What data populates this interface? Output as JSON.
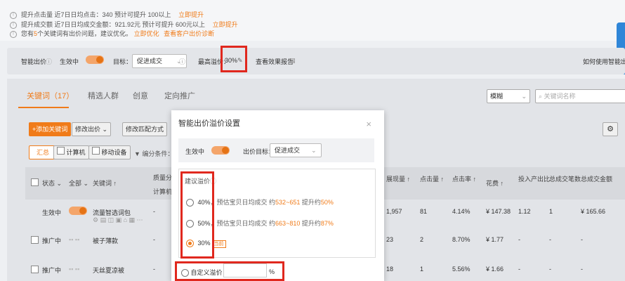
{
  "notice": {
    "rows": [
      {
        "text": "提升点击量 近7日日均点击：340    预计可提升 100以上",
        "link": "立即提升"
      },
      {
        "text": "提升成交额 近7日日均成交金额：921.92元    预计可提升 600元以上",
        "link": "立即提升"
      },
      {
        "text_prefix": "您有",
        "count": "5",
        "text_suffix": "个关键词有出价问题，建议优化。",
        "link": "立即优化",
        "link2": "查看客户出价诊断"
      }
    ]
  },
  "control_bar": {
    "smart_bid_label": "智能出价",
    "status_label": "生效中",
    "goal_label": "目标：",
    "goal_value": "促进成交",
    "max_premium_label": "最高溢价：",
    "max_premium_value": "30%",
    "report_link": "查看效果报告",
    "help_link": "如何使用智能出"
  },
  "tabs": [
    {
      "label": "关键词（17）",
      "active": true
    },
    {
      "label": "精选人群",
      "active": false
    },
    {
      "label": "创意",
      "active": false
    },
    {
      "label": "定向推广",
      "active": false
    }
  ],
  "filter": {
    "match_select": "模糊",
    "search_placeholder": "关键词名称"
  },
  "toolbar": {
    "add_keyword": "+添加关键词",
    "modify_bid": "修改出价",
    "modify_match": "修改匹配方式",
    "summary": "汇总",
    "computer": "计算机",
    "mobile": "移动设备",
    "filter_label": "▼ 编分条件："
  },
  "table": {
    "headers": {
      "status": "状态",
      "all": "全部",
      "keyword": "关键词 ↑",
      "quality": "质量分",
      "quality_sub": "计算机",
      "impressions": "展现量 ↑",
      "clicks": "点击量 ↑",
      "ctr": "点击率 ↑",
      "cost": "花费 ↑",
      "roi": "投入产出比",
      "total_deals": "总成交笔数",
      "total_amount": "总成交金额"
    },
    "rows": [
      {
        "status": "生效中",
        "keyword": "流量智选词包",
        "quality": "-",
        "impressions": "1,957",
        "clicks": "81",
        "ctr": "4.14%",
        "cost": "¥ 147.38",
        "roi": "1.12",
        "deals": "1",
        "amount": "¥ 165.66",
        "toggle": true
      },
      {
        "status": "推广中",
        "keyword": "被子薄款",
        "quality": "-",
        "impressions": "23",
        "clicks": "2",
        "ctr": "8.70%",
        "cost": "¥ 1.77",
        "roi": "-",
        "deals": "-",
        "amount": "-",
        "toggle": false
      },
      {
        "status": "推广中",
        "keyword": "天丝夏凉被",
        "quality": "-",
        "impressions": "18",
        "clicks": "1",
        "ctr": "5.56%",
        "cost": "¥ 1.66",
        "roi": "-",
        "deals": "-",
        "amount": "-",
        "toggle": false
      }
    ]
  },
  "modal": {
    "title": "智能出价溢价设置",
    "close": "×",
    "status_label": "生效中",
    "goal_label": "出价目标：",
    "goal_value": "促进成交",
    "suggest_label": "建议溢价",
    "options": [
      {
        "value": "40%",
        "desc_prefix": "，预估宝贝日均成交 约",
        "range": "532~651",
        "desc_mid": " 提升约",
        "lift": "50%",
        "checked": false
      },
      {
        "value": "50%",
        "desc_prefix": "，预估宝贝日均成交 约",
        "range": "663~810",
        "desc_mid": " 提升约",
        "lift": "87%",
        "checked": false
      },
      {
        "value": "30%",
        "tag": "当前",
        "checked": true
      }
    ],
    "custom_label": "自定义溢价：",
    "custom_unit": "%"
  },
  "colors": {
    "accent": "#f07b19",
    "highlight_box": "#e0281e"
  }
}
